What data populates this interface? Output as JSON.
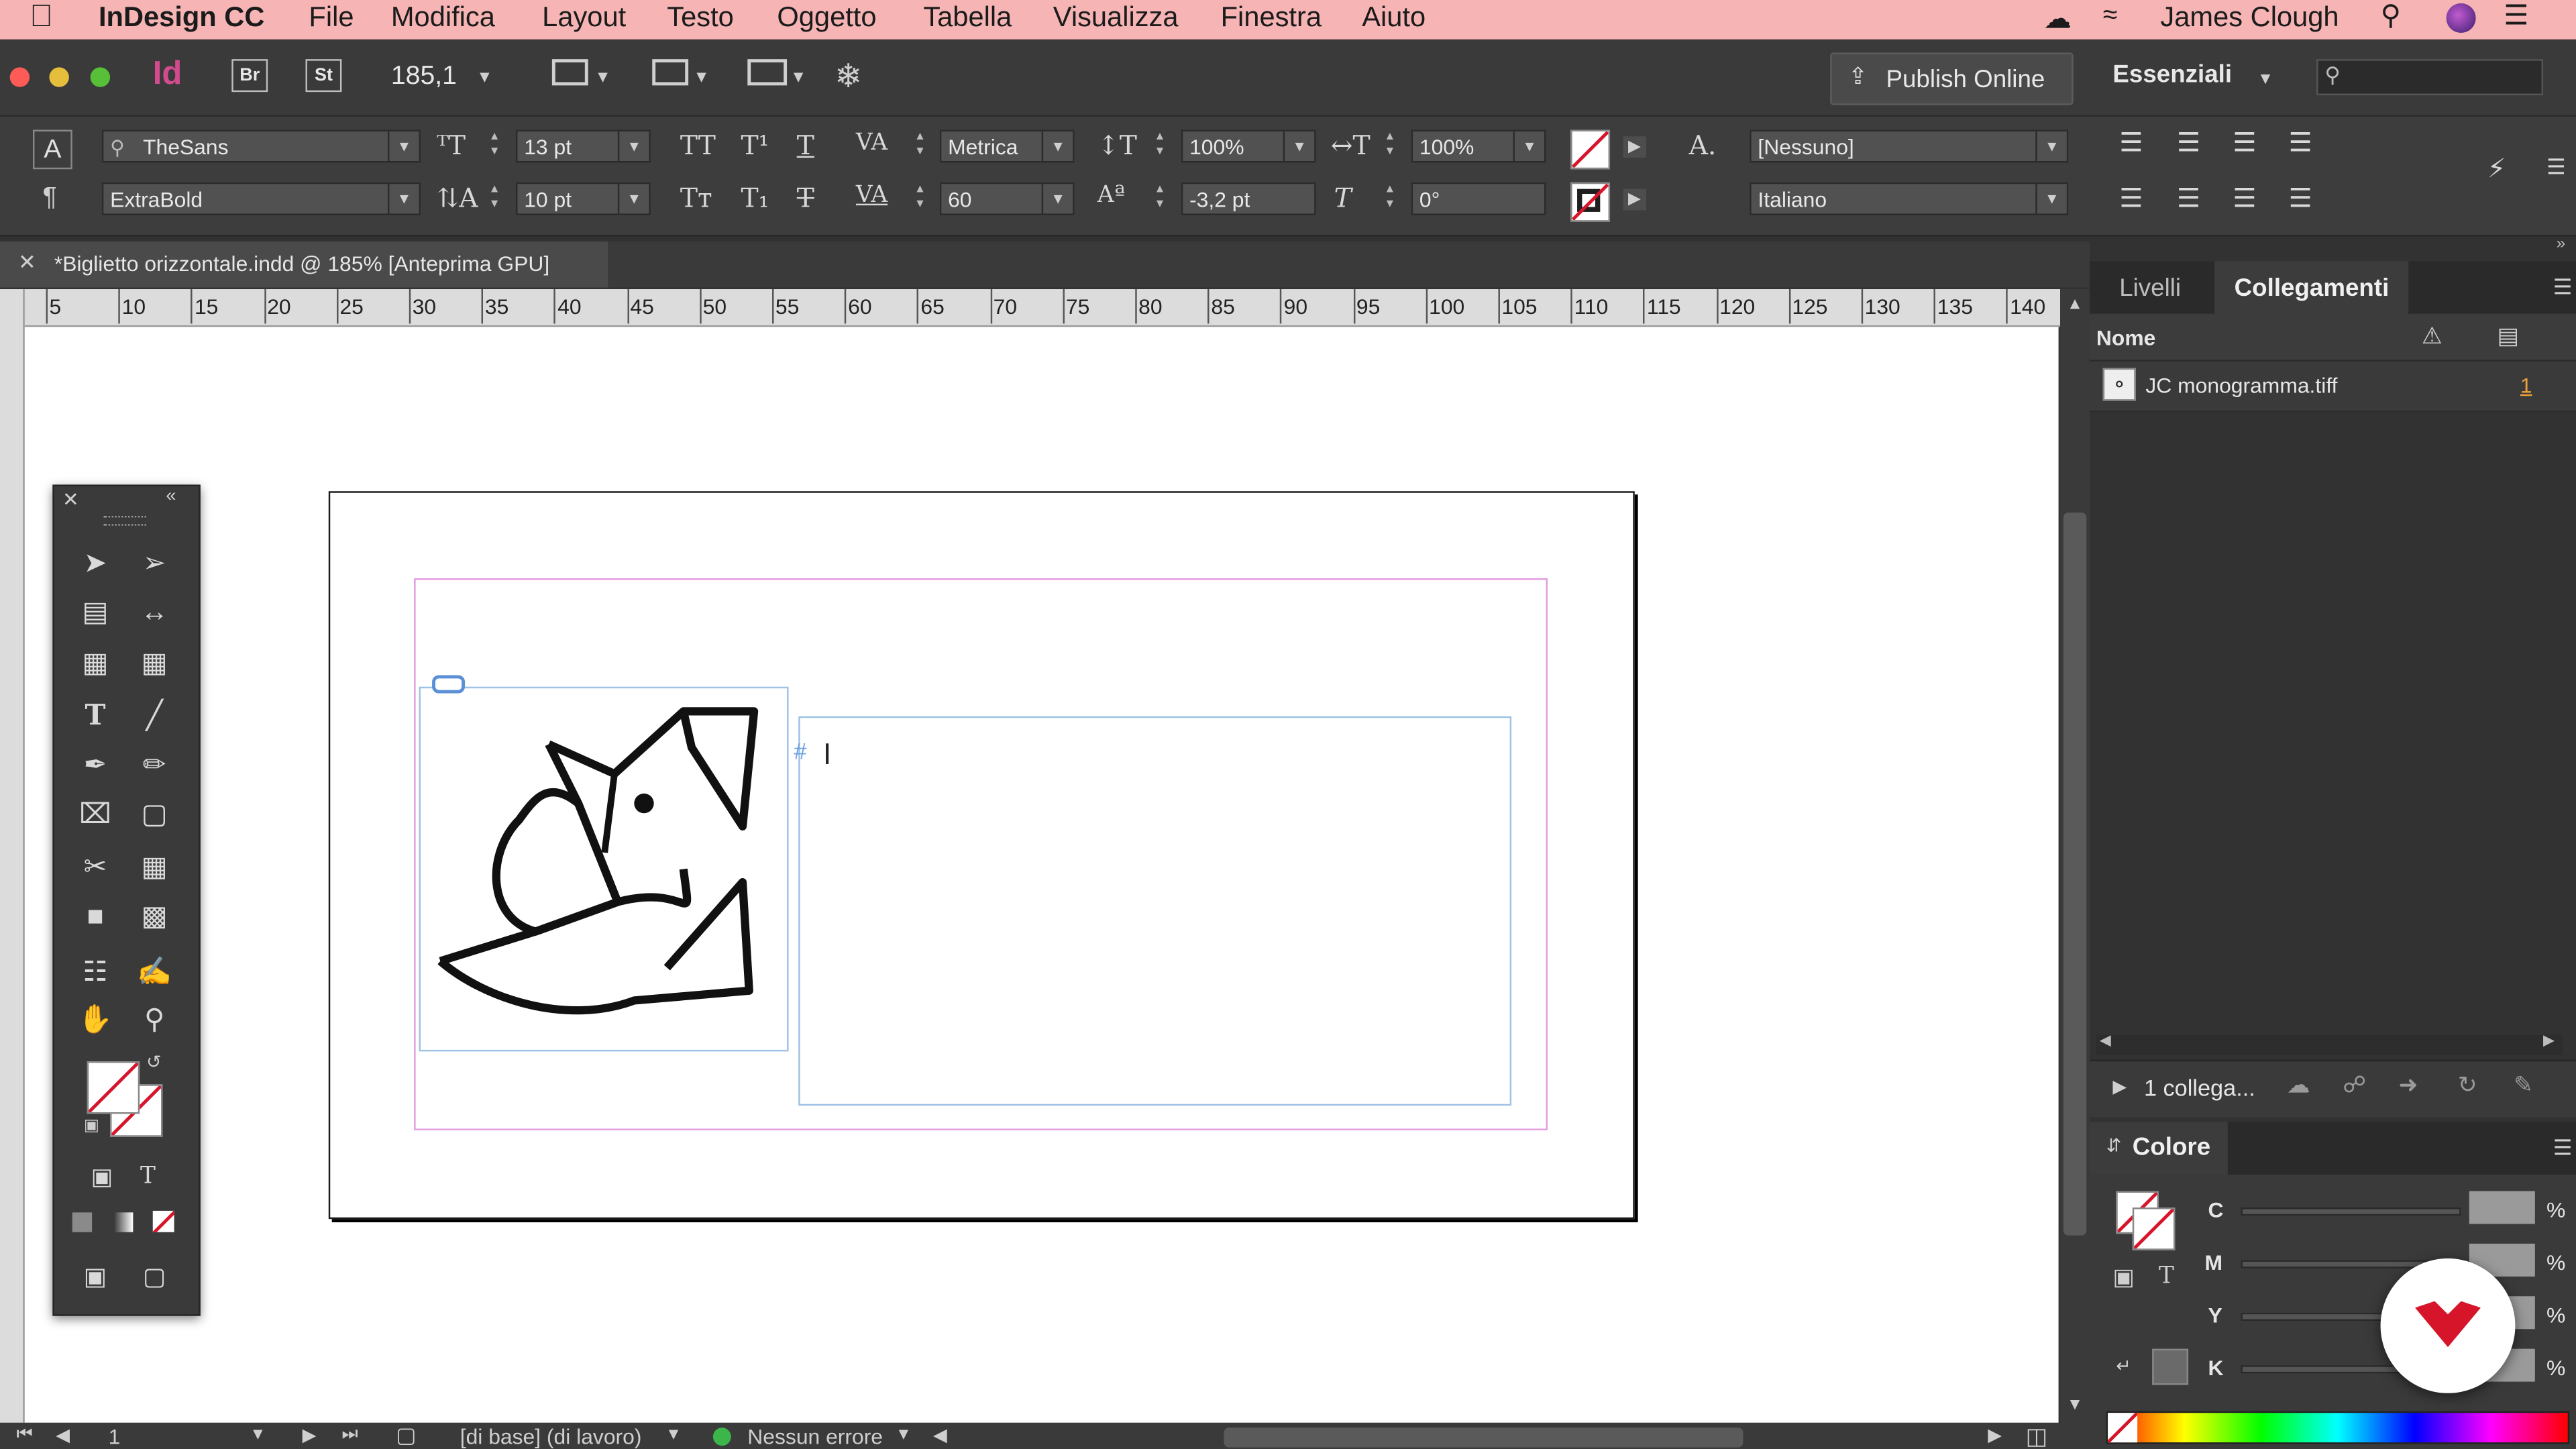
{
  "menubar": {
    "app_name": "InDesign CC",
    "items": [
      "File",
      "Modifica",
      "Layout",
      "Testo",
      "Oggetto",
      "Tabella",
      "Visualizza",
      "Finestra",
      "Aiuto"
    ],
    "user": "James Clough"
  },
  "app_toolbar": {
    "app_logo": "Id",
    "bridge": "Br",
    "stock": "St",
    "zoom": "185,1",
    "publish_label": "Publish Online",
    "workspace": "Essenziali"
  },
  "control_panel": {
    "font_family": "TheSans",
    "font_style": "ExtraBold",
    "font_size": "13 pt",
    "leading": "10 pt",
    "kerning": "Metrica",
    "tracking": "60",
    "vertical_scale": "100%",
    "horizontal_scale": "100%",
    "baseline_shift": "-3,2 pt",
    "skew": "0°",
    "char_style": "[Nessuno]",
    "language": "Italiano"
  },
  "doc_tab": {
    "title": "*Biglietto orizzontale.indd @ 185% [Anteprima GPU]"
  },
  "ruler": {
    "ticks": [
      "5",
      "10",
      "15",
      "20",
      "25",
      "30",
      "35",
      "40",
      "45",
      "50",
      "55",
      "60",
      "65",
      "70",
      "75",
      "80",
      "85",
      "90",
      "95",
      "100",
      "105",
      "110",
      "115",
      "120",
      "125",
      "130",
      "135",
      "140"
    ]
  },
  "right_panel": {
    "tabs": [
      "Livelli",
      "Collegamenti"
    ],
    "links_header": "Nome",
    "link_file": "JC monogramma.tiff",
    "link_page": "1",
    "links_count": "1 collega...",
    "color_panel_title": "Colore",
    "color_channels": [
      "C",
      "M",
      "Y",
      "K"
    ],
    "percent": "%"
  },
  "status_bar": {
    "page": "1",
    "master": "[di base] (di lavoro)",
    "errors": "Nessun errore"
  },
  "colors": {
    "menubar_bg": "#f6b4b4",
    "margin_guide": "#e39be0",
    "frame_guide": "#9ec1e6",
    "brand_red": "#d7152a"
  }
}
